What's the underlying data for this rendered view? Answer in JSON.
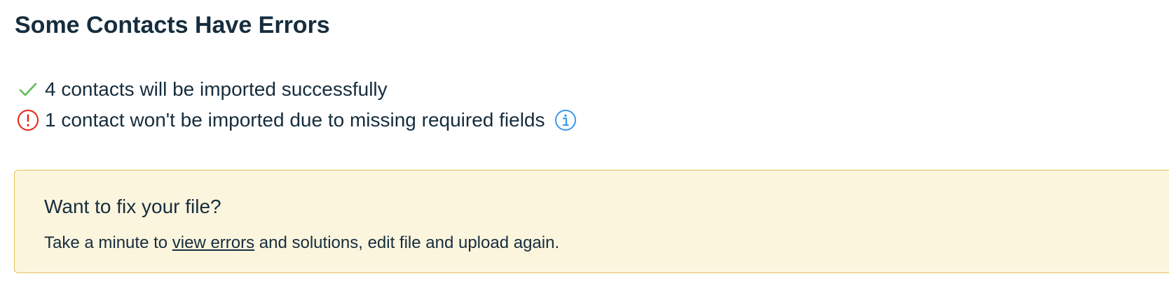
{
  "header": {
    "title": "Some Contacts Have Errors"
  },
  "summary": {
    "success": {
      "icon": "check-icon",
      "color": "#60bc57",
      "text": "4 contacts will be imported successfully"
    },
    "error": {
      "icon": "error-icon",
      "color": "#e62214",
      "text": "1 contact won't be imported due to missing required fields",
      "info_icon": "info-icon",
      "info_color": "#3899ec"
    }
  },
  "notice": {
    "title": "Want to fix your file?",
    "body_before": "Take a minute to ",
    "link_text": "view errors",
    "body_after": " and solutions, edit file and upload again.",
    "background": "#fcf5de",
    "border": "#e5c155"
  }
}
